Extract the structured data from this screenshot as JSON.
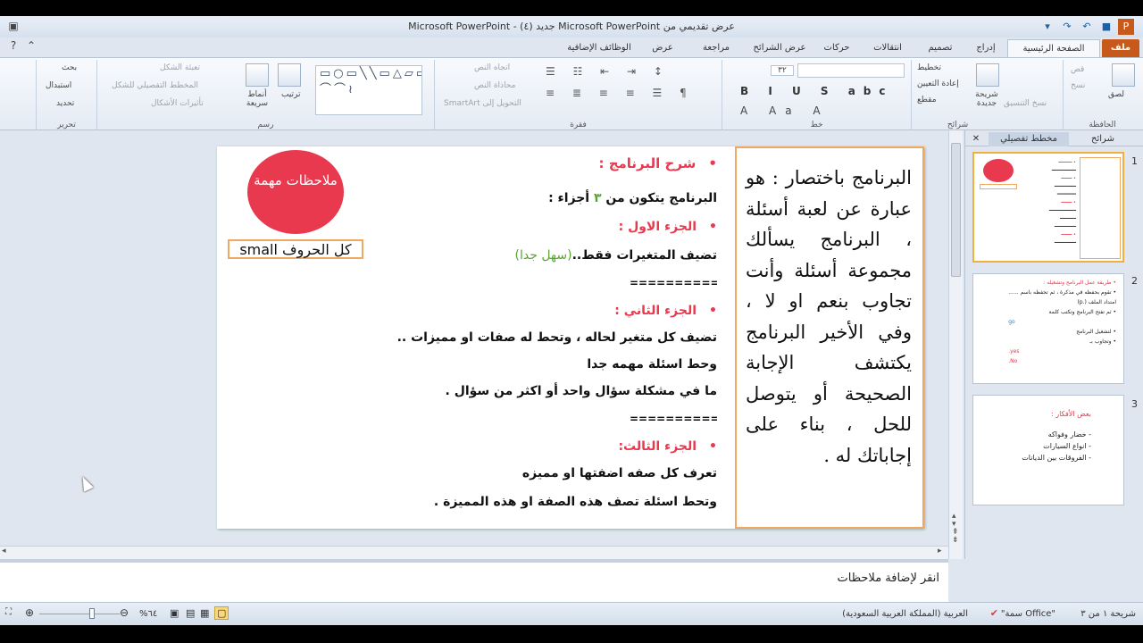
{
  "window": {
    "title": "عرض تقديمي من Microsoft PowerPoint جديد (٤)  -  Microsoft PowerPoint",
    "minimize": "–",
    "maximize": "▢",
    "close": "✕"
  },
  "tabs": [
    {
      "label": "ملف"
    },
    {
      "label": "الصفحة الرئيسية"
    },
    {
      "label": "إدراج"
    },
    {
      "label": "تصميم"
    },
    {
      "label": "انتقالات"
    },
    {
      "label": "حركات"
    },
    {
      "label": "عرض الشرائح"
    },
    {
      "label": "مراجعة"
    },
    {
      "label": "عرض"
    },
    {
      "label": "الوظائف الإضافية"
    }
  ],
  "ribbon": {
    "clipboard": {
      "name": "الحافظة",
      "paste": "لصق",
      "cut": "قص",
      "copy": "نسخ",
      "format_painter": "نسخ التنسيق"
    },
    "slides": {
      "name": "شرائح",
      "new_slide": "شريحة جديدة",
      "layout": "تخطيط",
      "reset": "إعادة التعيين",
      "section": "مقطع"
    },
    "font": {
      "name": "خط",
      "size": "٣٢"
    },
    "paragraph": {
      "name": "فقرة",
      "text_direction": "اتجاه النص",
      "align_text": "محاذاة النص",
      "smartart": "التحويل إلى SmartArt"
    },
    "drawing": {
      "name": "رسم",
      "arrange": "ترتيب",
      "quick_styles": "أنماط سريعة",
      "shape_fill": "تعبئة الشكل",
      "shape_outline": "المخطط التفصيلي للشكل",
      "shape_effects": "تأثيرات الأشكال"
    },
    "editing": {
      "name": "تحرير",
      "find": "بحث",
      "replace": "استبدال",
      "select": "تحديد"
    }
  },
  "panel": {
    "tab_slides": "شرائح",
    "tab_outline": "مخطط تفصيلي",
    "thumb_nums": [
      "1",
      "2",
      "3"
    ],
    "thumb3_title": "بعض الأفكار :",
    "thumb3_items": [
      "- خضار وفواكه",
      "- انواع السيارات",
      "- الفروقات بين الديانات"
    ],
    "thumb2_lines": [
      "• طريقة عمل البرنامج وتشغيله :",
      "• تقوم بحفظه في مذكرة ، ثم تحفظه باسم ......",
      "امتداد الملف (.p)",
      "• ثم تفتح البرنامج وتكتب كلمة",
      "go",
      "• لتشغيل البرنامج",
      "• وتجاوب بـ",
      "yes.",
      "No."
    ]
  },
  "slide": {
    "badge": "ملاحظات مهمة",
    "small_note": "كل الحروف small",
    "heading": "شرح البرنامج :",
    "intro_a": "البرنامج يتكون من ",
    "intro_num": "٣",
    "intro_b": " أجزاء :",
    "part1_title": "الجزء الاول :",
    "part1_text_a": "تضيف المتغيرات فقط..",
    "part1_text_b": "(سهل جدا)",
    "sep": "============",
    "part2_title": "الجزء الثاني :",
    "part2_l1": "تضيف كل متغير لحاله ، وتحط له صفات او مميزات ..",
    "part2_l2": "وحط اسئلة مهمه جدا",
    "part2_l3": "ما في مشكلة سؤال واحد أو اكثر من سؤال .",
    "part3_title": "الجزء الثالث:",
    "part3_l1": "تعرف كل صفه اضفتها او مميزه",
    "part3_l2": "وتحط اسئلة تصف هذه الصفة او هذه المميزة .",
    "right_text": "البرنامج باختصار : هو عبارة عن لعبة أسئلة ، البرنامج يسألك مجموعة أسئلة وأنت تجاوب بنعم او لا ، وفي الأخير البرنامج يكتشف الإجابة الصحيحة أو يتوصل للحل ، بناء على إجاباتك له ."
  },
  "notes": {
    "placeholder": "انقر لإضافة ملاحظات"
  },
  "status": {
    "slide_info": "شريحة ١ من ٣",
    "theme": "\"سمة Office\"",
    "language": "العربية (المملكة العربية السعودية)",
    "zoom": "%٦٤"
  }
}
